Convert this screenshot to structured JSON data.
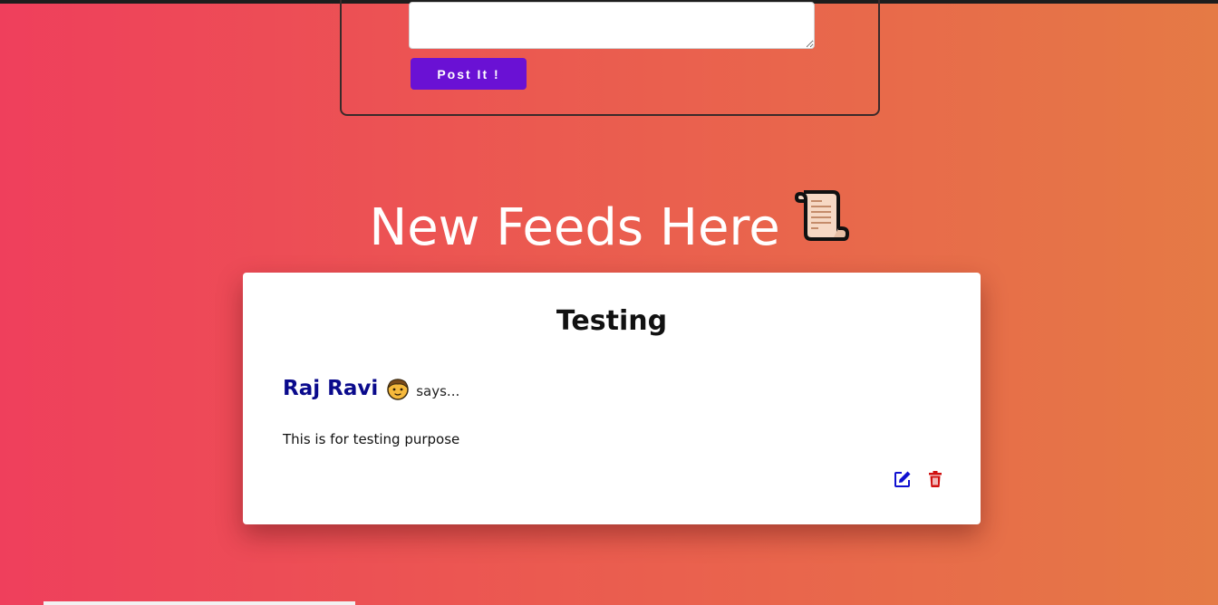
{
  "composer": {
    "textarea_value": "",
    "post_button_label": "Post It !"
  },
  "feeds": {
    "heading": "New Feeds Here",
    "heading_icon": "scroll-icon"
  },
  "posts": [
    {
      "title": "Testing",
      "author": "Raj Ravi",
      "author_icon": "boy-emoji-icon",
      "says_label": "says...",
      "body": "This is for testing purpose",
      "actions": {
        "edit_icon": "edit-icon",
        "delete_icon": "trash-icon"
      }
    }
  ],
  "colors": {
    "background_start": "#ef3f5c",
    "background_end": "#e57a45",
    "post_button": "#6a11d4",
    "author_name": "#0a0a8c",
    "edit_icon": "#1010d0",
    "delete_icon": "#d01010"
  }
}
